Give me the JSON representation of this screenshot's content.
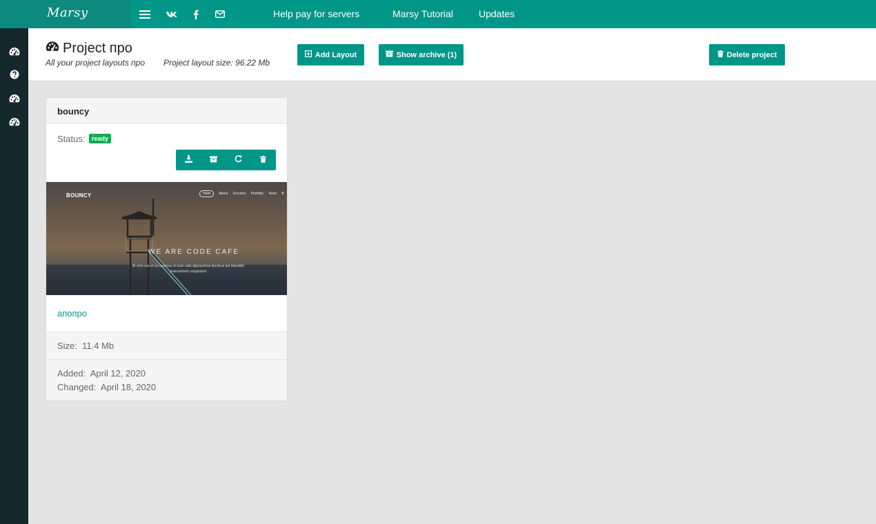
{
  "nav": {
    "brand": "Marsy",
    "links": [
      "Help pay for servers",
      "Marsy Tutorial",
      "Updates"
    ]
  },
  "sidebar": {
    "icons": [
      "dashboard-icon",
      "help-icon",
      "dashboard-icon",
      "dashboard-icon"
    ]
  },
  "header": {
    "title": "Project про",
    "subtitle": "All your project layouts про",
    "size_text": "Project layout size: 96.22 Mb",
    "buttons": {
      "add_layout": "Add Layout",
      "show_archive": "Show archive (1)",
      "delete_project": "Delete project"
    }
  },
  "card": {
    "title": "bouncy",
    "status_label": "Status:",
    "status_value": "ready",
    "actions": [
      "download-icon",
      "archive-icon",
      "refresh-icon",
      "trash-icon"
    ],
    "preview": {
      "logo": "BOUNCY",
      "nav": [
        "Hello",
        "About",
        "Services",
        "Portfolio",
        "Team",
        "B"
      ],
      "headline": "WE ARE CODE CAFE",
      "text": "At vero eos et accusamus et iusto odio dignissimos ducimus qui blanditiis praesentium voluptatum"
    },
    "layout_name": "апопро",
    "size_label": "Size:",
    "size_value": "11.4 Mb",
    "added_label": "Added:",
    "added_value": "April 12, 2020",
    "changed_label": "Changed:",
    "changed_value": "April 18, 2020"
  },
  "colors": {
    "accent": "#009688",
    "sidebar": "#15282d",
    "badge": "#0ab04a"
  }
}
